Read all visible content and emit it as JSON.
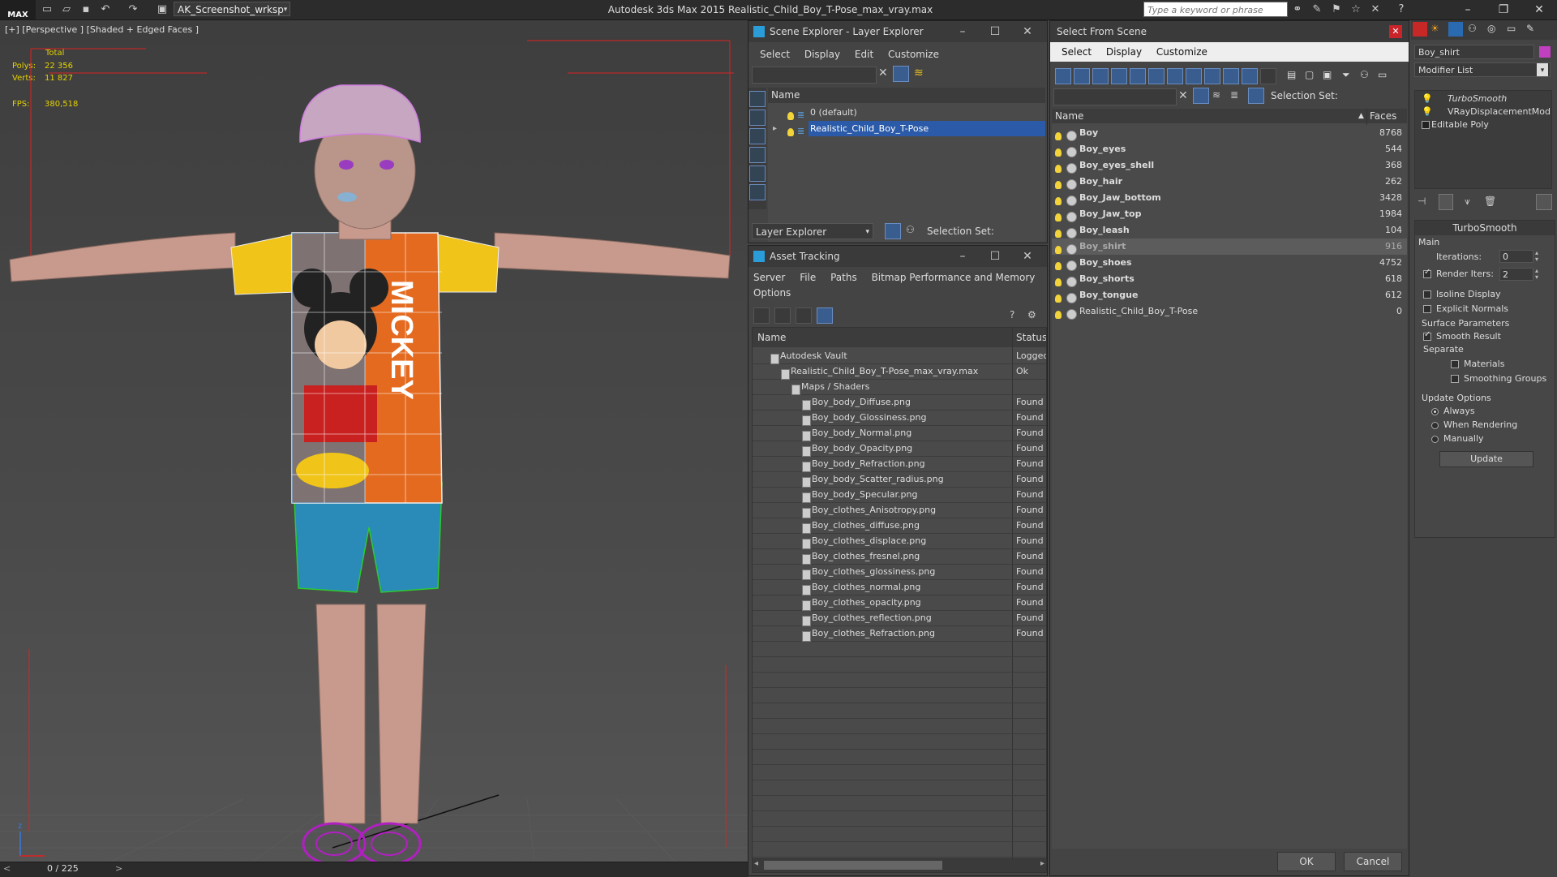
{
  "topbar": {
    "logo": "MAX",
    "workspace": "AK_Screenshot_wrksp",
    "app_title": "Autodesk 3ds Max  2015     Realistic_Child_Boy_T-Pose_max_vray.max",
    "search_placeholder": "Type a keyword or phrase"
  },
  "viewport": {
    "label": "[+] [Perspective ] [Shaded + Edged Faces ]",
    "stats": {
      "total_label": "Total",
      "polys_label": "Polys:",
      "polys_value": "22 356",
      "verts_label": "Verts:",
      "verts_value": "11 827",
      "fps_label": "FPS:",
      "fps_value": "380,518"
    },
    "shirt_text": "MICKEY",
    "axis_z": "z",
    "timeline": "0 / 225"
  },
  "scene_explorer": {
    "title": "Scene Explorer - Layer Explorer",
    "menu": [
      "Select",
      "Display",
      "Edit",
      "Customize"
    ],
    "column_name": "Name",
    "rows": [
      {
        "label": "0 (default)",
        "selected": false
      },
      {
        "label": "Realistic_Child_Boy_T-Pose",
        "selected": true
      }
    ],
    "footer_dropdown": "Layer Explorer",
    "selection_set_label": "Selection Set:"
  },
  "asset_tracking": {
    "title": "Asset Tracking",
    "menu": [
      "Server",
      "File",
      "Paths",
      "Bitmap Performance and Memory"
    ],
    "menu2": "Options",
    "col_name": "Name",
    "col_status": "Status",
    "rows": [
      {
        "name": "Autodesk Vault",
        "status": "Logged",
        "indent": 0
      },
      {
        "name": "Realistic_Child_Boy_T-Pose_max_vray.max",
        "status": "Ok",
        "indent": 1
      },
      {
        "name": "Maps / Shaders",
        "status": "",
        "indent": 2
      },
      {
        "name": "Boy_body_Diffuse.png",
        "status": "Found",
        "indent": 3
      },
      {
        "name": "Boy_body_Glossiness.png",
        "status": "Found",
        "indent": 3
      },
      {
        "name": "Boy_body_Normal.png",
        "status": "Found",
        "indent": 3
      },
      {
        "name": "Boy_body_Opacity.png",
        "status": "Found",
        "indent": 3
      },
      {
        "name": "Boy_body_Refraction.png",
        "status": "Found",
        "indent": 3
      },
      {
        "name": "Boy_body_Scatter_radius.png",
        "status": "Found",
        "indent": 3
      },
      {
        "name": "Boy_body_Specular.png",
        "status": "Found",
        "indent": 3
      },
      {
        "name": "Boy_clothes_Anisotropy.png",
        "status": "Found",
        "indent": 3
      },
      {
        "name": "Boy_clothes_diffuse.png",
        "status": "Found",
        "indent": 3
      },
      {
        "name": "Boy_clothes_displace.png",
        "status": "Found",
        "indent": 3
      },
      {
        "name": "Boy_clothes_fresnel.png",
        "status": "Found",
        "indent": 3
      },
      {
        "name": "Boy_clothes_glossiness.png",
        "status": "Found",
        "indent": 3
      },
      {
        "name": "Boy_clothes_normal.png",
        "status": "Found",
        "indent": 3
      },
      {
        "name": "Boy_clothes_opacity.png",
        "status": "Found",
        "indent": 3
      },
      {
        "name": "Boy_clothes_reflection.png",
        "status": "Found",
        "indent": 3
      },
      {
        "name": "Boy_clothes_Refraction.png",
        "status": "Found",
        "indent": 3
      }
    ]
  },
  "select_from_scene": {
    "title": "Select From Scene",
    "menu": [
      "Select",
      "Display",
      "Customize"
    ],
    "selection_set_label": "Selection Set:",
    "col_name": "Name",
    "col_faces": "Faces",
    "rows": [
      {
        "name": "Boy",
        "faces": "8768",
        "selected": false,
        "bold": true
      },
      {
        "name": "Boy_eyes",
        "faces": "544",
        "selected": false,
        "bold": true
      },
      {
        "name": "Boy_eyes_shell",
        "faces": "368",
        "selected": false,
        "bold": true
      },
      {
        "name": "Boy_hair",
        "faces": "262",
        "selected": false,
        "bold": true
      },
      {
        "name": "Boy_Jaw_bottom",
        "faces": "3428",
        "selected": false,
        "bold": true
      },
      {
        "name": "Boy_Jaw_top",
        "faces": "1984",
        "selected": false,
        "bold": true
      },
      {
        "name": "Boy_leash",
        "faces": "104",
        "selected": false,
        "bold": true
      },
      {
        "name": "Boy_shirt",
        "faces": "916",
        "selected": true,
        "bold": true
      },
      {
        "name": "Boy_shoes",
        "faces": "4752",
        "selected": false,
        "bold": true
      },
      {
        "name": "Boy_shorts",
        "faces": "618",
        "selected": false,
        "bold": true
      },
      {
        "name": "Boy_tongue",
        "faces": "612",
        "selected": false,
        "bold": true
      },
      {
        "name": "Realistic_Child_Boy_T-Pose",
        "faces": "0",
        "selected": false,
        "bold": false
      }
    ],
    "ok_label": "OK",
    "cancel_label": "Cancel"
  },
  "command_panel": {
    "object_name": "Boy_shirt",
    "modifier_list": "Modifier List",
    "stack": [
      "TurboSmooth",
      "VRayDisplacementMod",
      "Editable Poly"
    ],
    "rollout_title": "TurboSmooth",
    "main_label": "Main",
    "iterations_label": "Iterations:",
    "iterations_value": "0",
    "render_iters_label": "Render Iters:",
    "render_iters_value": "2",
    "isoline_label": "Isoline Display",
    "explicit_normals_label": "Explicit Normals",
    "surface_params_label": "Surface Parameters",
    "smooth_result_label": "Smooth Result",
    "separate_label": "Separate",
    "materials_label": "Materials",
    "smoothing_groups_label": "Smoothing Groups",
    "update_options_label": "Update Options",
    "always_label": "Always",
    "when_rendering_label": "When Rendering",
    "manually_label": "Manually",
    "update_button": "Update"
  }
}
